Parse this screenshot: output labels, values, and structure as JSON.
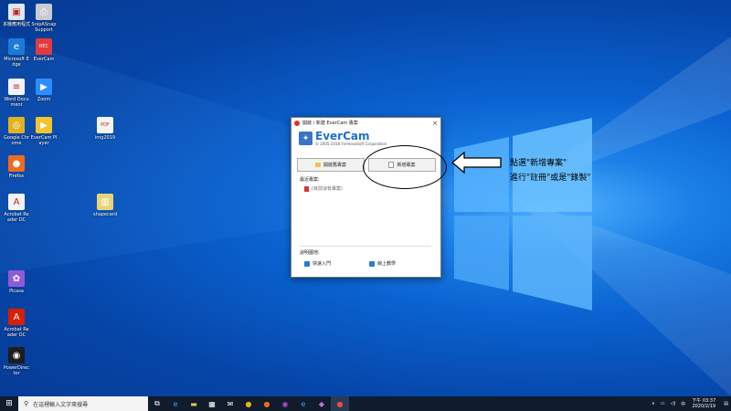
{
  "desktop": {
    "icons": [
      {
        "label": "本機應用程式",
        "icon": "pc-icon",
        "color": "#dfe8f5"
      },
      {
        "label": "SnipASnap Support",
        "icon": "printer-icon",
        "color": "#c9cbd0"
      },
      {
        "label": "Microsoft Edge",
        "icon": "edge-icon",
        "color": "#1b7bd8"
      },
      {
        "label": "EverCam",
        "icon": "rec-icon",
        "color": "#e33b3b"
      },
      {
        "label": "Word Document",
        "icon": "doc-icon",
        "color": "#f4f4f4"
      },
      {
        "label": "Zoom",
        "icon": "zoom-icon",
        "color": "#2d8cff"
      },
      {
        "label": "Google Chrome",
        "icon": "chrome-icon",
        "color": "#e0b21d"
      },
      {
        "label": "EverCam Player",
        "icon": "player-icon",
        "color": "#f2c42b"
      },
      {
        "label": "img2019",
        "icon": "pdf-file-icon",
        "color": "#f4f4f4"
      },
      {
        "label": "Firefox",
        "icon": "firefox-icon",
        "color": "#ef6b1d"
      },
      {
        "label": "Acrobat Reader DC",
        "icon": "acrobat-icon",
        "color": "#f4f4f4"
      },
      {
        "label": "shapecard",
        "icon": "zip-file-icon",
        "color": "#e9d47a"
      },
      {
        "label": "Picasa",
        "icon": "picasa-icon",
        "color": "#8e5bd8"
      },
      {
        "label": "Acrobat Reader DC",
        "icon": "acrobat-icon",
        "color": "#d81e05"
      },
      {
        "label": "PowerDirector",
        "icon": "director-icon",
        "color": "#1d1d1d"
      }
    ]
  },
  "window": {
    "title": "開啟 / 新建 EverCam 專案",
    "close": "×",
    "logo_name": "EverCam",
    "copyright": "© 2005-2018 FormosaSoft Corporation",
    "open_button": "開啟舊專案",
    "new_button": "新增專案",
    "recent_header": "最近專案:",
    "recent_item": "(目前沒有專案)",
    "help_header": "說明園地:",
    "quickstart_link": "快速入門",
    "online_link": "線上教學"
  },
  "annotation": {
    "line1": "點選\"新增專案\"",
    "line2": "進行\"註冊\"或是\"錄製\""
  },
  "taskbar": {
    "search_placeholder": "在這裡輸入文字來搜尋",
    "time": "下午 03:37",
    "date": "2020/2/19"
  }
}
